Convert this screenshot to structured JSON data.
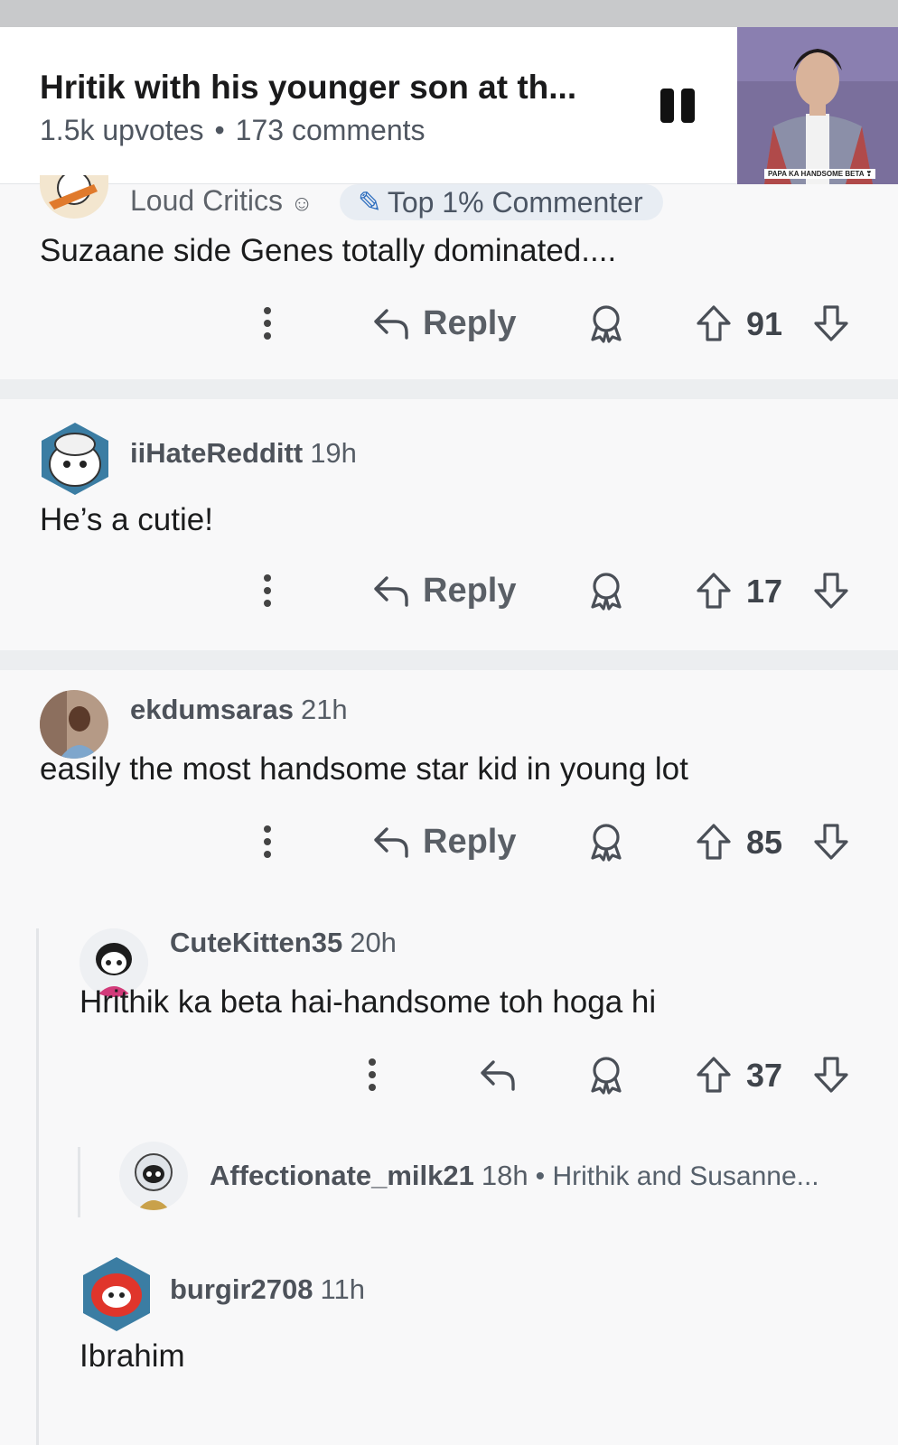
{
  "post": {
    "title": "Hritik with his younger son at th...",
    "upvotes": "1.5k upvotes",
    "separator": "•",
    "comments": "173 comments",
    "thumbnail_caption": "PAPA KA HANDSOME BETA ❣"
  },
  "comments": [
    {
      "username": "Loud Critics",
      "badge": "Top 1% Commenter",
      "body": "Suzaane side Genes totally dominated....",
      "reply_label": "Reply",
      "score": "91"
    },
    {
      "username": "iiHateRedditt",
      "time": "19h",
      "body": "He’s a cutie!",
      "reply_label": "Reply",
      "score": "17"
    },
    {
      "username": "ekdumsaras",
      "time": "21h",
      "body": "easily the most handsome star kid in young lot",
      "reply_label": "Reply",
      "score": "85"
    },
    {
      "username": "CuteKitten35",
      "time": "20h",
      "body": "Hrithik ka beta hai-handsome toh hoga hi",
      "score": "37"
    },
    {
      "username": "Affectionate_milk21",
      "time": "18h",
      "snippet": "• Hrithik and Susanne..."
    },
    {
      "username": "burgir2708",
      "time": "11h",
      "body": "Ibrahim"
    }
  ],
  "icons": [
    "more-icon",
    "reply-icon",
    "award-icon",
    "upvote-icon",
    "downvote-icon",
    "pause-icon"
  ],
  "colors": {
    "background": "#f7f8f9",
    "separator": "#eceef0",
    "badge": "#e8edf3"
  }
}
